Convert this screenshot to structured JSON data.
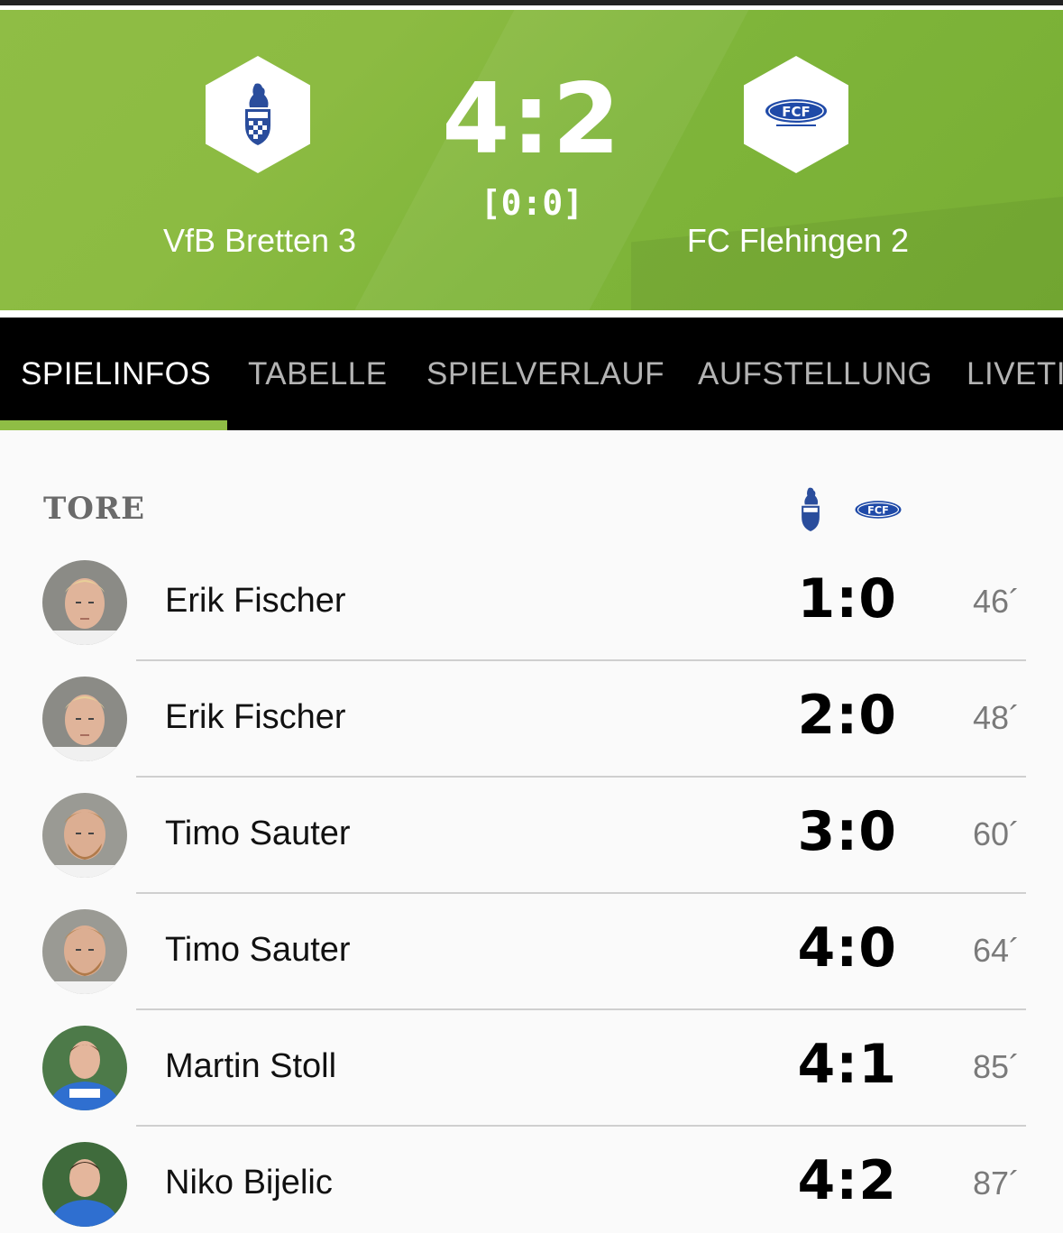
{
  "match": {
    "home_team": "VfB Bretten 3",
    "away_team": "FC Flehingen 2",
    "score": "4:2",
    "halftime": "[0:0]",
    "home_crest_icon": "vfb-bretten-crest",
    "away_crest_icon": "fc-flehingen-crest",
    "hero_color": "#8cbb42"
  },
  "tabs": [
    {
      "label": "SPIELINFOS",
      "active": true
    },
    {
      "label": "TABELLE",
      "active": false
    },
    {
      "label": "SPIELVERLAUF",
      "active": false
    },
    {
      "label": "AUFSTELLUNG",
      "active": false
    },
    {
      "label": "LIVETI",
      "active": false
    }
  ],
  "goals": {
    "title": "TORE",
    "rows": [
      {
        "player": "Erik Fischer",
        "score": "1:0",
        "minute": "46´",
        "avatar": "player-photo"
      },
      {
        "player": "Erik Fischer",
        "score": "2:0",
        "minute": "48´",
        "avatar": "player-photo"
      },
      {
        "player": "Timo Sauter",
        "score": "3:0",
        "minute": "60´",
        "avatar": "player-photo"
      },
      {
        "player": "Timo Sauter",
        "score": "4:0",
        "minute": "64´",
        "avatar": "player-photo"
      },
      {
        "player": "Martin Stoll",
        "score": "4:1",
        "minute": "85´",
        "avatar": "player-photo"
      },
      {
        "player": "Niko Bijelic",
        "score": "4:2",
        "minute": "87´",
        "avatar": "player-photo"
      }
    ]
  }
}
